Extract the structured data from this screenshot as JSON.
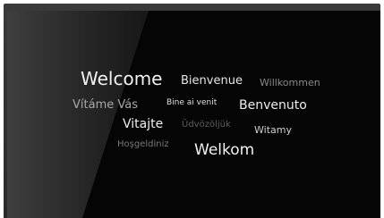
{
  "greetings": {
    "welcome": "Welcome",
    "bienvenue": "Bienvenue",
    "willkommen": "Willkommen",
    "vitame_vas": "Vítáme Vás",
    "bine_ai_venit": "Bine ai venit",
    "benvenuto": "Benvenuto",
    "vitajte": "Vitajte",
    "udvozoljuk": "Üdvözöljük",
    "witamy": "Witamy",
    "hosgeldiniz": "Hoşgeldiniz",
    "welkom": "Welkom"
  },
  "colors": {
    "screen": "#050505",
    "bezel": "#333333",
    "text_bright": "#f2f2f2",
    "text_mid": "#bdbdbd",
    "text_dim": "#8a8a8a",
    "text_faint": "#5e5e5e"
  }
}
